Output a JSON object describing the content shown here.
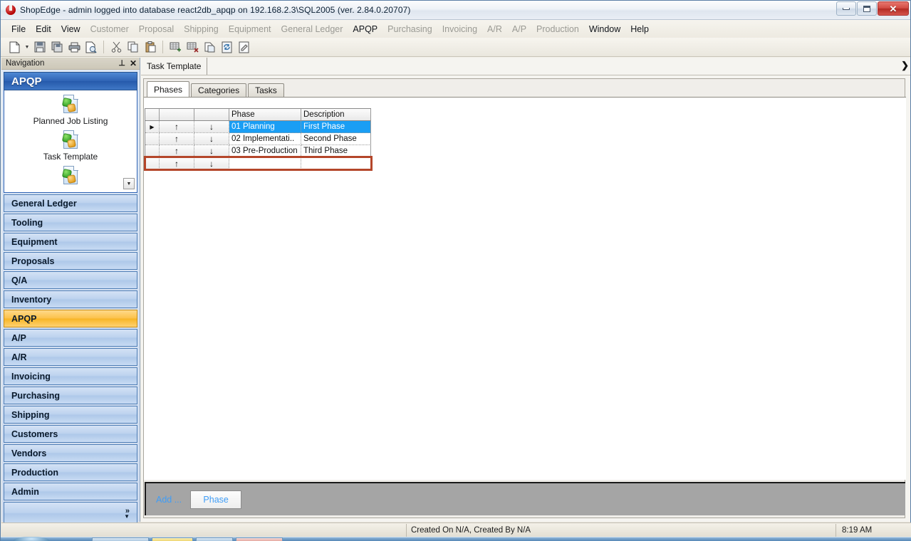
{
  "window": {
    "title": "ShopEdge - admin logged into database react2db_apqp on 192.168.2.3\\SQL2005 (ver. 2.84.0.20707)",
    "app_icon": "shopedge-logo-icon",
    "controls": {
      "minimize": "minimize-icon",
      "maximize": "maximize-icon",
      "close": "close-icon"
    }
  },
  "menubar": {
    "items": [
      {
        "label": "File",
        "enabled": true
      },
      {
        "label": "Edit",
        "enabled": true
      },
      {
        "label": "View",
        "enabled": true
      },
      {
        "label": "Customer",
        "enabled": false
      },
      {
        "label": "Proposal",
        "enabled": false
      },
      {
        "label": "Shipping",
        "enabled": false
      },
      {
        "label": "Equipment",
        "enabled": false
      },
      {
        "label": "General Ledger",
        "enabled": false
      },
      {
        "label": "APQP",
        "enabled": true
      },
      {
        "label": "Purchasing",
        "enabled": false
      },
      {
        "label": "Invoicing",
        "enabled": false
      },
      {
        "label": "A/R",
        "enabled": false
      },
      {
        "label": "A/P",
        "enabled": false
      },
      {
        "label": "Production",
        "enabled": false
      },
      {
        "label": "Window",
        "enabled": true
      },
      {
        "label": "Help",
        "enabled": true
      }
    ]
  },
  "toolbar": {
    "buttons": [
      "new-document-icon",
      "new-document-dropdown-caret-icon",
      "save-icon",
      "save-all-icon",
      "print-icon",
      "print-preview-icon",
      "cut-icon",
      "copy-icon",
      "paste-icon",
      "add-row-icon",
      "delete-row-icon",
      "copy-row-icon",
      "refresh-icon",
      "edit-note-icon"
    ]
  },
  "navigation": {
    "header": {
      "title": "Navigation",
      "pin_icon": "pin-icon",
      "close_icon": "close-icon"
    },
    "group": {
      "title": "APQP",
      "items": [
        {
          "label": "Planned Job Listing",
          "icon": "apqp-document-icon"
        },
        {
          "label": "Task Template",
          "icon": "apqp-document-icon"
        },
        {
          "label": "",
          "icon": "apqp-document-icon"
        }
      ],
      "scroll_down_icon": "chevron-down-icon"
    },
    "buttons": [
      {
        "label": "General Ledger",
        "active": false
      },
      {
        "label": "Tooling",
        "active": false
      },
      {
        "label": "Equipment",
        "active": false
      },
      {
        "label": "Proposals",
        "active": false
      },
      {
        "label": "Q/A",
        "active": false
      },
      {
        "label": "Inventory",
        "active": false
      },
      {
        "label": "APQP",
        "active": true
      },
      {
        "label": "A/P",
        "active": false
      },
      {
        "label": "A/R",
        "active": false
      },
      {
        "label": "Invoicing",
        "active": false
      },
      {
        "label": "Purchasing",
        "active": false
      },
      {
        "label": "Shipping",
        "active": false
      },
      {
        "label": "Customers",
        "active": false
      },
      {
        "label": "Vendors",
        "active": false
      },
      {
        "label": "Production",
        "active": false
      },
      {
        "label": "Admin",
        "active": false
      }
    ],
    "more": {
      "chevrons_icon": "double-chevron-right-icon",
      "down_icon": "chevron-down-icon"
    }
  },
  "document": {
    "tabs": [
      {
        "label": "Task Template",
        "active": true
      }
    ],
    "overflow_arrow_icon": "chevron-right-icon"
  },
  "form": {
    "tabs": [
      {
        "label": "Phases",
        "active": true
      },
      {
        "label": "Categories",
        "active": false
      },
      {
        "label": "Tasks",
        "active": false
      }
    ],
    "grid": {
      "columns": [
        {
          "key": "indicator",
          "label": ""
        },
        {
          "key": "move_up",
          "label": ""
        },
        {
          "key": "move_down",
          "label": ""
        },
        {
          "key": "phase",
          "label": "Phase"
        },
        {
          "key": "description",
          "label": "Description"
        }
      ],
      "up_icon": "arrow-up-icon",
      "down_icon": "arrow-down-icon",
      "current_row_marker": "▶",
      "rows": [
        {
          "indicator": "current",
          "up": "↑",
          "down": "↓",
          "phase": "01 Planning",
          "description": "First Phase",
          "selected": true,
          "new": false
        },
        {
          "indicator": "",
          "up": "↑",
          "down": "↓",
          "phase": "02  Implementati..",
          "description": "Second Phase",
          "selected": false,
          "new": false
        },
        {
          "indicator": "",
          "up": "↑",
          "down": "↓",
          "phase": "03 Pre-Production",
          "description": "Third Phase",
          "selected": false,
          "new": false
        },
        {
          "indicator": "",
          "up": "↑",
          "down": "↓",
          "phase": "",
          "description": "",
          "selected": false,
          "new": true
        }
      ]
    },
    "actionbar": {
      "add_label": "Add ...",
      "phase_button": "Phase"
    }
  },
  "statusbar": {
    "left": "",
    "message": "Created On N/A, Created By N/A",
    "time": "8:19 AM"
  },
  "colors": {
    "accent_blue": "#2f63b4",
    "active_nav": "#fcc24b",
    "selection": "#1a9ef4",
    "new_row_outline": "#b4462a",
    "link_text": "#3f9df7"
  }
}
